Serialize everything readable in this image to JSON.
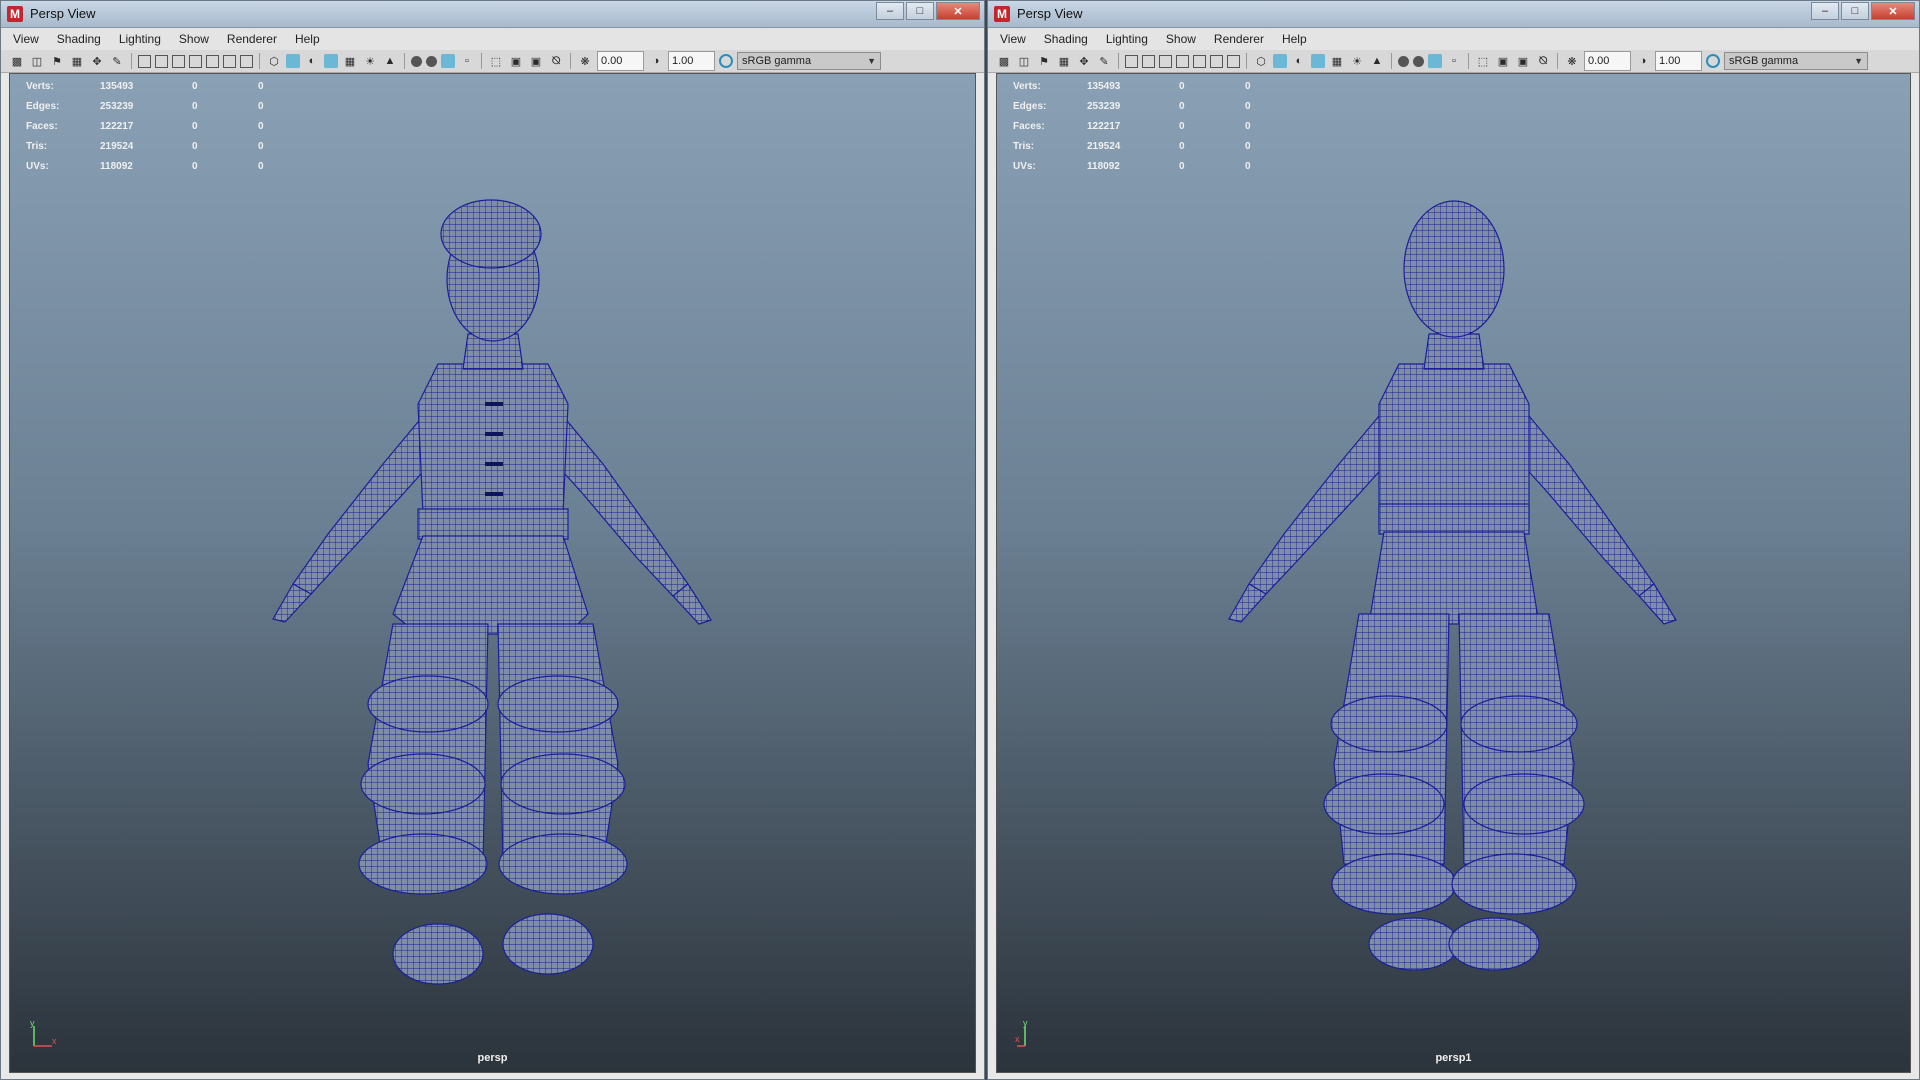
{
  "left": {
    "title": "Persp View",
    "menus": [
      "View",
      "Shading",
      "Lighting",
      "Show",
      "Renderer",
      "Help"
    ],
    "toolbar": {
      "exposure": "0.00",
      "gamma": "1.00",
      "color_space": "sRGB gamma"
    },
    "stats": [
      {
        "label": "Verts:",
        "value": "135493",
        "z1": "0",
        "z2": "0"
      },
      {
        "label": "Edges:",
        "value": "253239",
        "z1": "0",
        "z2": "0"
      },
      {
        "label": "Faces:",
        "value": "122217",
        "z1": "0",
        "z2": "0"
      },
      {
        "label": "Tris:",
        "value": "219524",
        "z1": "0",
        "z2": "0"
      },
      {
        "label": "UVs:",
        "value": "118092",
        "z1": "0",
        "z2": "0"
      }
    ],
    "camera": "persp",
    "axis_y": "y",
    "axis_x": "x"
  },
  "right": {
    "title": "Persp View",
    "menus": [
      "View",
      "Shading",
      "Lighting",
      "Show",
      "Renderer",
      "Help"
    ],
    "toolbar": {
      "exposure": "0.00",
      "gamma": "1.00",
      "color_space": "sRGB gamma"
    },
    "stats": [
      {
        "label": "Verts:",
        "value": "135493",
        "z1": "0",
        "z2": "0"
      },
      {
        "label": "Edges:",
        "value": "253239",
        "z1": "0",
        "z2": "0"
      },
      {
        "label": "Faces:",
        "value": "122217",
        "z1": "0",
        "z2": "0"
      },
      {
        "label": "Tris:",
        "value": "219524",
        "z1": "0",
        "z2": "0"
      },
      {
        "label": "UVs:",
        "value": "118092",
        "z1": "0",
        "z2": "0"
      }
    ],
    "camera": "persp1",
    "axis_y": "y",
    "axis_x": "x"
  },
  "app_logo": "M",
  "colors": {
    "wireframe": "#1a1f9a",
    "mesh_fill": "#7f8ea4",
    "accent": "#c4262e"
  }
}
